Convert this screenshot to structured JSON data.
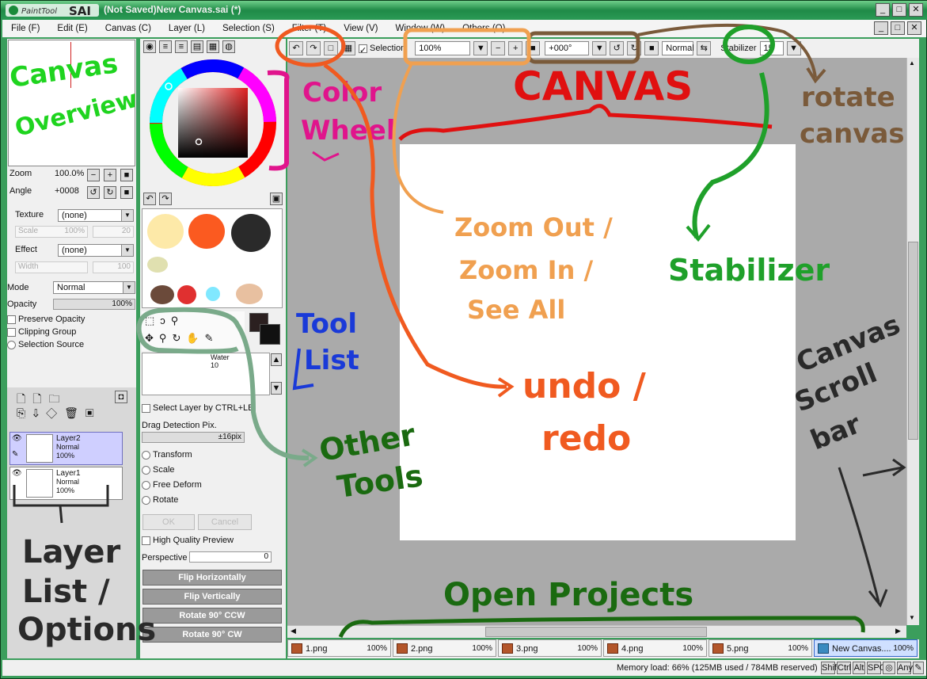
{
  "window": {
    "app_logo": "PaintTool SAI",
    "title": "(Not Saved)New Canvas.sai (*)",
    "controls": [
      "_",
      "□",
      "✕"
    ]
  },
  "menu": [
    "File (F)",
    "Edit (E)",
    "Canvas (C)",
    "Layer (L)",
    "Selection (S)",
    "Filter (T)",
    "View (V)",
    "Window (W)",
    "Others (O)"
  ],
  "navigator": {
    "zoom_label": "Zoom",
    "zoom_value": "100.0%",
    "angle_label": "Angle",
    "angle_value": "+0008"
  },
  "layer_props": {
    "texture_label": "Texture",
    "texture_value": "(none)",
    "scale_label": "Scale",
    "scale_value": "100%",
    "scale_num": "20",
    "effect_label": "Effect",
    "effect_value": "(none)",
    "width_label": "Width",
    "width_num": "100",
    "mode_label": "Mode",
    "mode_value": "Normal",
    "opacity_label": "Opacity",
    "opacity_value": "100%",
    "preserve_opacity": "Preserve Opacity",
    "clipping_group": "Clipping Group",
    "selection_source": "Selection Source"
  },
  "layers": [
    {
      "name": "Layer2",
      "mode": "Normal",
      "opacity": "100%",
      "active": true
    },
    {
      "name": "Layer1",
      "mode": "Normal",
      "opacity": "100%",
      "active": false
    }
  ],
  "swatch_colors": [
    "#fde9a8",
    "#fb5a20",
    "#2a2a2a",
    "#e0e0b0",
    "#6b4a3a",
    "#e03030",
    "#80e8ff",
    "#e8c0a0"
  ],
  "tool_options": {
    "brush_label": "Water",
    "brush_size": "10",
    "select_layer": "Select Layer by CTRL+LB",
    "drag_detection_label": "Drag Detection Pix.",
    "drag_detection_value": "±16pix",
    "transform": "Transform",
    "scale": "Scale",
    "free_deform": "Free Deform",
    "rotate": "Rotate",
    "ok": "OK",
    "cancel": "Cancel",
    "hq_preview": "High Quality Preview",
    "perspective_label": "Perspective",
    "perspective_value": "0",
    "flip_h": "Flip Horizontally",
    "flip_v": "Flip Vertically",
    "rot_ccw": "Rotate 90° CCW",
    "rot_cw": "Rotate 90° CW"
  },
  "canvas_toolbar": {
    "selection_label": "Selection",
    "zoom_value": "100%",
    "angle_value": "+000°",
    "blend_value": "Normal",
    "stabilizer_label": "Stabilizer",
    "stabilizer_value": "15"
  },
  "tabs": [
    {
      "name": "1.png",
      "pct": "100%"
    },
    {
      "name": "2.png",
      "pct": "100%"
    },
    {
      "name": "3.png",
      "pct": "100%"
    },
    {
      "name": "4.png",
      "pct": "100%"
    },
    {
      "name": "5.png",
      "pct": "100%"
    },
    {
      "name": "New Canvas....",
      "pct": "100%",
      "active": true
    }
  ],
  "status": {
    "memory": "Memory load: 66% (125MB used / 784MB reserved)",
    "keys": [
      "Shift",
      "Ctrl",
      "Alt",
      "SPC",
      "Any"
    ]
  },
  "annotations": {
    "canvas_overview": [
      "Canvas",
      "Overview"
    ],
    "color_wheel": [
      "Color",
      "Wheel"
    ],
    "canvas": "CANVAS",
    "rotate_canvas": [
      "rotate",
      "canvas"
    ],
    "zoom": [
      "Zoom Out /",
      "Zoom In /",
      "See All"
    ],
    "stabilizer": "Stabilizer",
    "tool_list": [
      "Tool",
      "List"
    ],
    "undo_redo": [
      "undo /",
      "redo"
    ],
    "other_tools": [
      "Other",
      "Tools"
    ],
    "canvas_scroll": [
      "Canvas",
      "Scroll",
      "bar"
    ],
    "layer_list": [
      "Layer",
      "List /",
      "Options"
    ],
    "open_projects": "Open Projects"
  },
  "colors": {
    "title_green": "#1f8a47",
    "canvas_gray": "#aaaaaa",
    "anno_green": "#1fd41f",
    "anno_magenta": "#e0148c",
    "anno_red": "#e01010",
    "anno_orange": "#f0a050",
    "anno_brown": "#7a5a3a",
    "anno_darkgreen": "#1a6a10",
    "anno_blue": "#1a3ad8",
    "anno_sage": "#7aaa8a"
  }
}
